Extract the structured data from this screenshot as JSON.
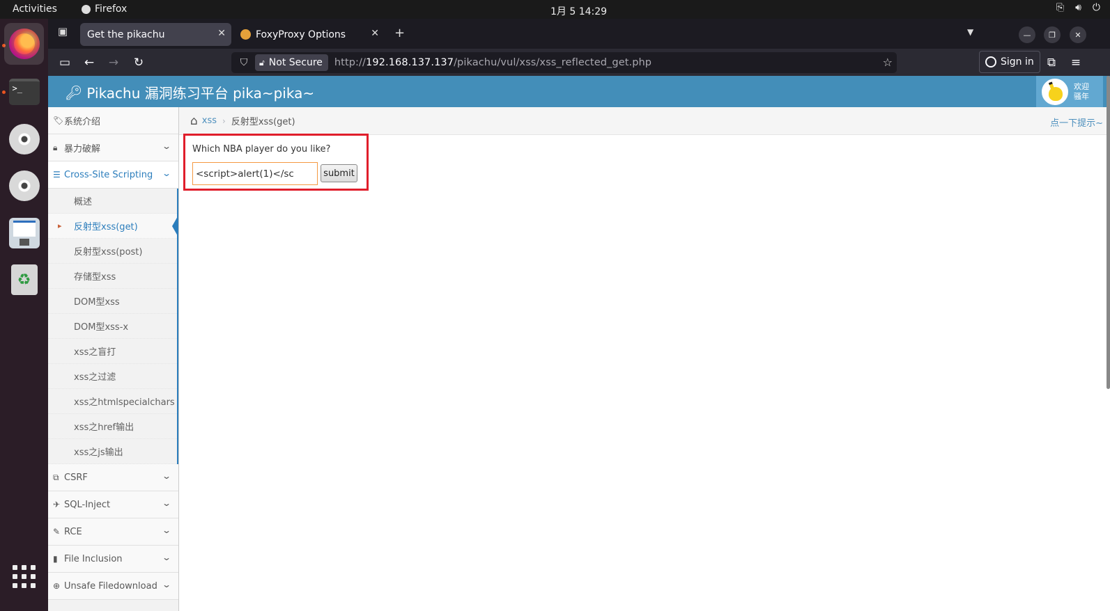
{
  "os": {
    "activities": "Activities",
    "app_name": "Firefox",
    "clock": "1月 5  14:29"
  },
  "browser": {
    "tabs": [
      {
        "title": "Get the pikachu",
        "selected": true
      },
      {
        "title": "FoxyProxy Options",
        "selected": false
      }
    ],
    "close_glyph": "✕",
    "new_tab_glyph": "+",
    "url": {
      "security_label": "Not Secure",
      "scheme": "http://",
      "host": "192.168.137.137",
      "path": "/pikachu/vul/xss/xss_reflected_get.php"
    },
    "sign_in": "Sign in"
  },
  "page": {
    "brand": "Pikachu 漏洞练习平台 pika~pika~",
    "welcome": [
      "欢迎",
      "骚年"
    ],
    "sidebar": {
      "top_items": [
        {
          "label": "系统介绍",
          "icon": "tag-icon",
          "has_chevron": false
        },
        {
          "label": "暴力破解",
          "icon": "lock-icon",
          "has_chevron": true
        }
      ],
      "open_section": {
        "label": "Cross-Site Scripting",
        "icon": "list-icon"
      },
      "sub_items": [
        {
          "label": "概述",
          "active": false
        },
        {
          "label": "反射型xss(get)",
          "active": true
        },
        {
          "label": "反射型xss(post)",
          "active": false
        },
        {
          "label": "存储型xss",
          "active": false
        },
        {
          "label": "DOM型xss",
          "active": false
        },
        {
          "label": "DOM型xss-x",
          "active": false
        },
        {
          "label": "xss之盲打",
          "active": false
        },
        {
          "label": "xss之过滤",
          "active": false
        },
        {
          "label": "xss之htmlspecialchars",
          "active": false
        },
        {
          "label": "xss之href输出",
          "active": false
        },
        {
          "label": "xss之js输出",
          "active": false
        }
      ],
      "bottom_items": [
        {
          "label": "CSRF",
          "icon": "external-link-icon"
        },
        {
          "label": "SQL-Inject",
          "icon": "plane-icon"
        },
        {
          "label": "RCE",
          "icon": "pencil-icon"
        },
        {
          "label": "File Inclusion",
          "icon": "file-icon"
        },
        {
          "label": "Unsafe Filedownload",
          "icon": "download-icon"
        }
      ]
    },
    "breadcrumb": {
      "link": "xss",
      "current": "反射型xss(get)",
      "hint": "点一下提示~"
    },
    "form": {
      "question": "Which NBA player do you like?",
      "input_value": "<script>alert(1)</sc",
      "submit_label": "submit"
    }
  },
  "colors": {
    "header_blue": "#438eb9",
    "link_blue": "#2b7dbc",
    "highlight_red": "#e01e2b",
    "input_orange": "#f59942"
  }
}
